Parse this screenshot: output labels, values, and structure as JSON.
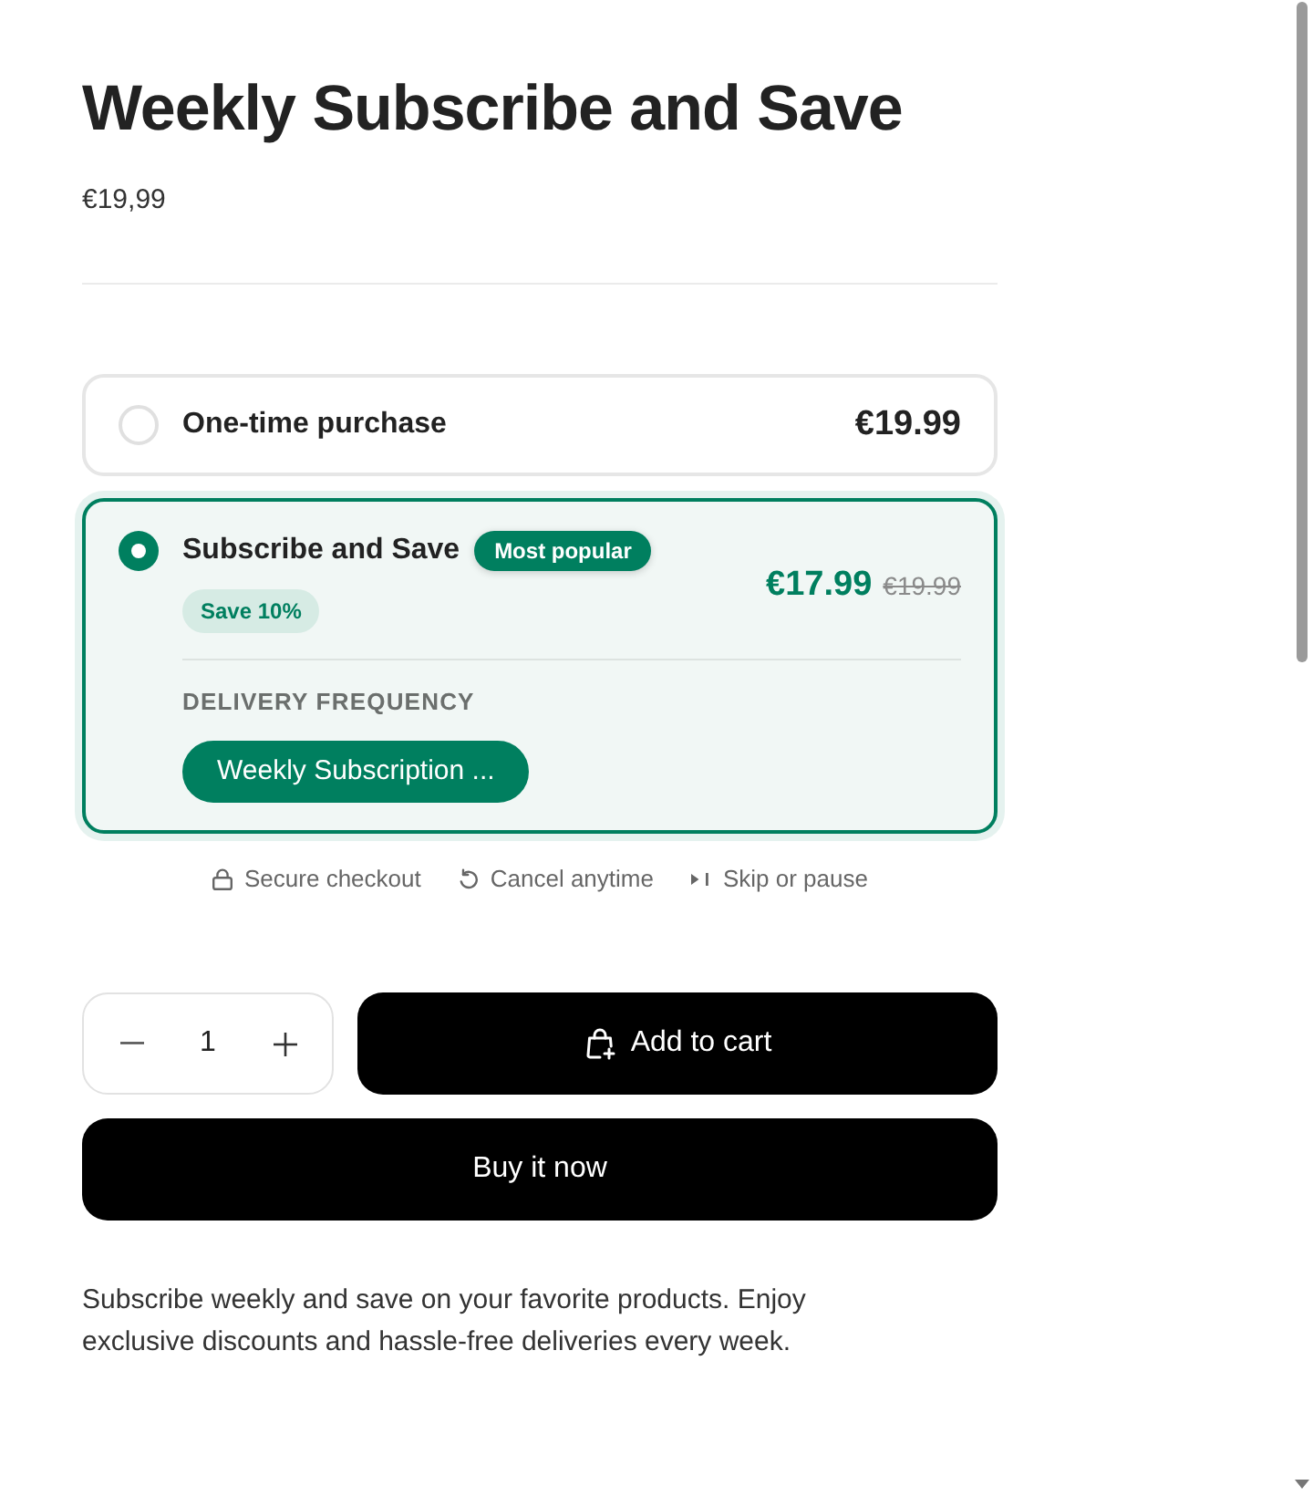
{
  "product": {
    "title": "Weekly Subscribe and Save",
    "price": "€19,99"
  },
  "purchase_options": [
    {
      "kind": "one_time",
      "label": "One-time purchase",
      "price": "€19.99",
      "selected": false
    },
    {
      "kind": "subscription",
      "label": "Subscribe and Save",
      "badge": "Most popular",
      "savings": "Save 10%",
      "price": "€17.99",
      "compare_price": "€19.99",
      "selected": true,
      "frequency_label": "DELIVERY FREQUENCY",
      "frequency_options": [
        {
          "label": "Weekly Subscription ...",
          "selected": true
        }
      ]
    }
  ],
  "trust_badges": [
    {
      "kind": "lock",
      "label": "Secure checkout"
    },
    {
      "kind": "cancel",
      "label": "Cancel anytime"
    },
    {
      "kind": "skip",
      "label": "Skip or pause"
    }
  ],
  "quantity": {
    "value": "1"
  },
  "add_to_cart": "Add to cart",
  "buy_now": "Buy it now",
  "description": "Subscribe weekly and save on your favorite products. Enjoy exclusive discounts and hassle-free deliveries every week."
}
